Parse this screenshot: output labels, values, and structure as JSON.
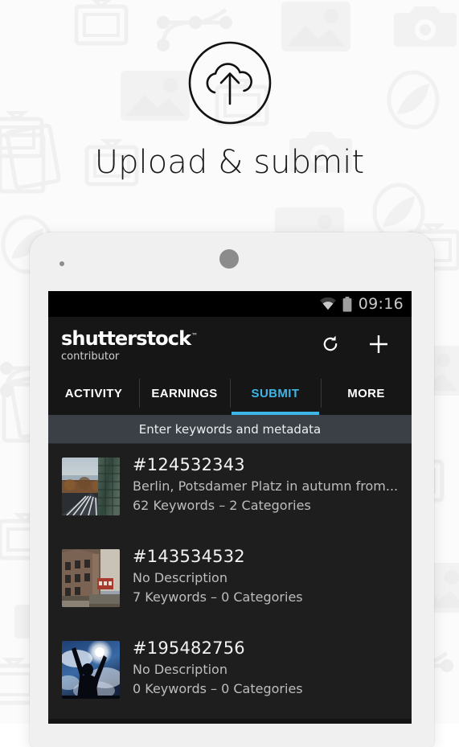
{
  "promo": {
    "headline": "Upload & submit",
    "badge_icon": "cloud-upload-icon",
    "background_pattern": "photography-icons-pattern",
    "background_color": "#fbfbfb",
    "headline_color": "#1c1c1c"
  },
  "device": {
    "body_color": "#f0f0f0",
    "earpiece_icon": "earpiece-speaker",
    "sensor_icon": "proximity-sensor"
  },
  "status_bar": {
    "wifi_icon": "wifi-icon",
    "battery_icon": "battery-icon",
    "clock": "09:16",
    "background": "#000000"
  },
  "app_bar": {
    "brand": "shutterstock",
    "brand_tm": "™",
    "subtitle": "contributor",
    "actions": [
      {
        "name": "refresh-button",
        "icon": "refresh-icon",
        "label": "Refresh"
      },
      {
        "name": "add-button",
        "icon": "plus-icon",
        "label": "Add"
      }
    ]
  },
  "tabs": {
    "active_color": "#3fb6e8",
    "items": [
      {
        "label": "ACTIVITY",
        "active": false
      },
      {
        "label": "EARNINGS",
        "active": false
      },
      {
        "label": "SUBMIT",
        "active": true
      },
      {
        "label": "MORE",
        "active": false
      }
    ]
  },
  "hint_bar": {
    "text": "Enter keywords and metadata",
    "background": "#3b4046"
  },
  "submissions": [
    {
      "id": "#124532343",
      "description": "Berlin, Potsdamer Platz in autumn from...",
      "meta": "62 Keywords – 2 Categories",
      "thumbnail": "berlin-potsdamer-platz-thumbnail"
    },
    {
      "id": "#143534532",
      "description": "No Description",
      "meta": "7 Keywords – 0 Categories",
      "thumbnail": "old-building-facade-thumbnail"
    },
    {
      "id": "#195482756",
      "description": "No Description",
      "meta": "0 Keywords – 0 Categories",
      "thumbnail": "statue-silhouette-sky-thumbnail"
    }
  ]
}
